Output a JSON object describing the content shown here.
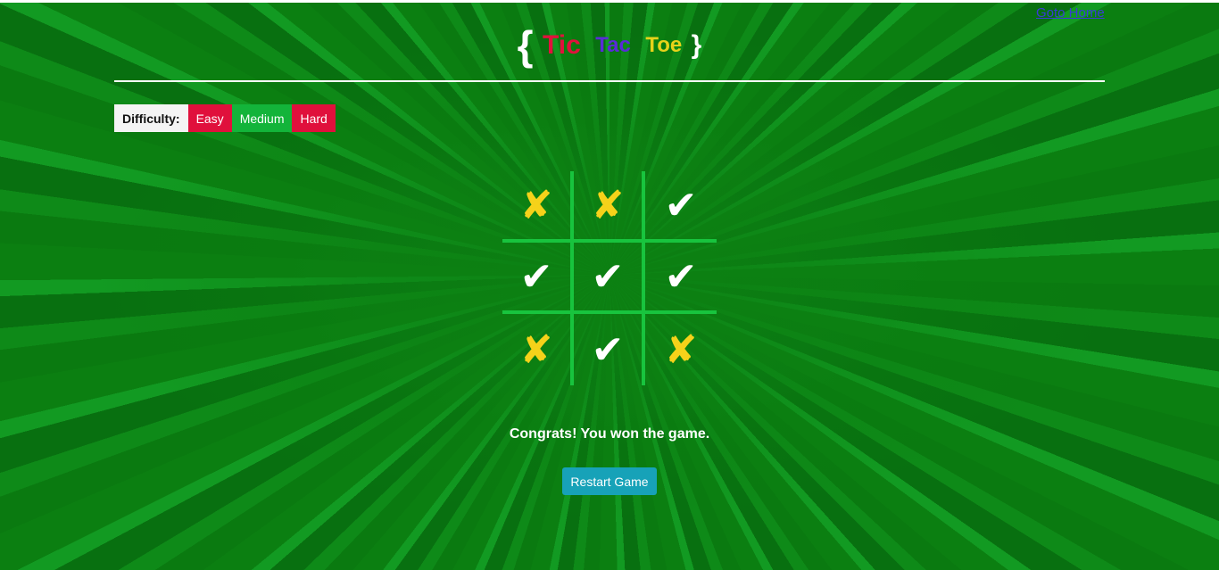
{
  "header": {
    "home_link": "Goto Home",
    "title": {
      "open_brace": "{",
      "tic": "Tic",
      "tac": "Tac",
      "toe": "Toe",
      "close_brace": "}"
    }
  },
  "difficulty": {
    "label": "Difficulty:",
    "options": [
      "Easy",
      "Medium",
      "Hard"
    ],
    "selected": "Medium"
  },
  "board": {
    "cells": [
      "✘",
      "✘",
      "✔",
      "✔",
      "✔",
      "✔",
      "✘",
      "✔",
      "✘"
    ]
  },
  "status": {
    "message": "Congrats! You won the game."
  },
  "actions": {
    "restart_label": "Restart Game"
  },
  "colors": {
    "background": "#0b7f11",
    "grid_lines": "#18c43e",
    "x_mark": "#f5d21a",
    "check_mark": "#ffffff",
    "tic": "#e0123c",
    "tac": "#5a2bd8",
    "toe": "#e6d21a",
    "restart_button": "#17a2b8"
  }
}
